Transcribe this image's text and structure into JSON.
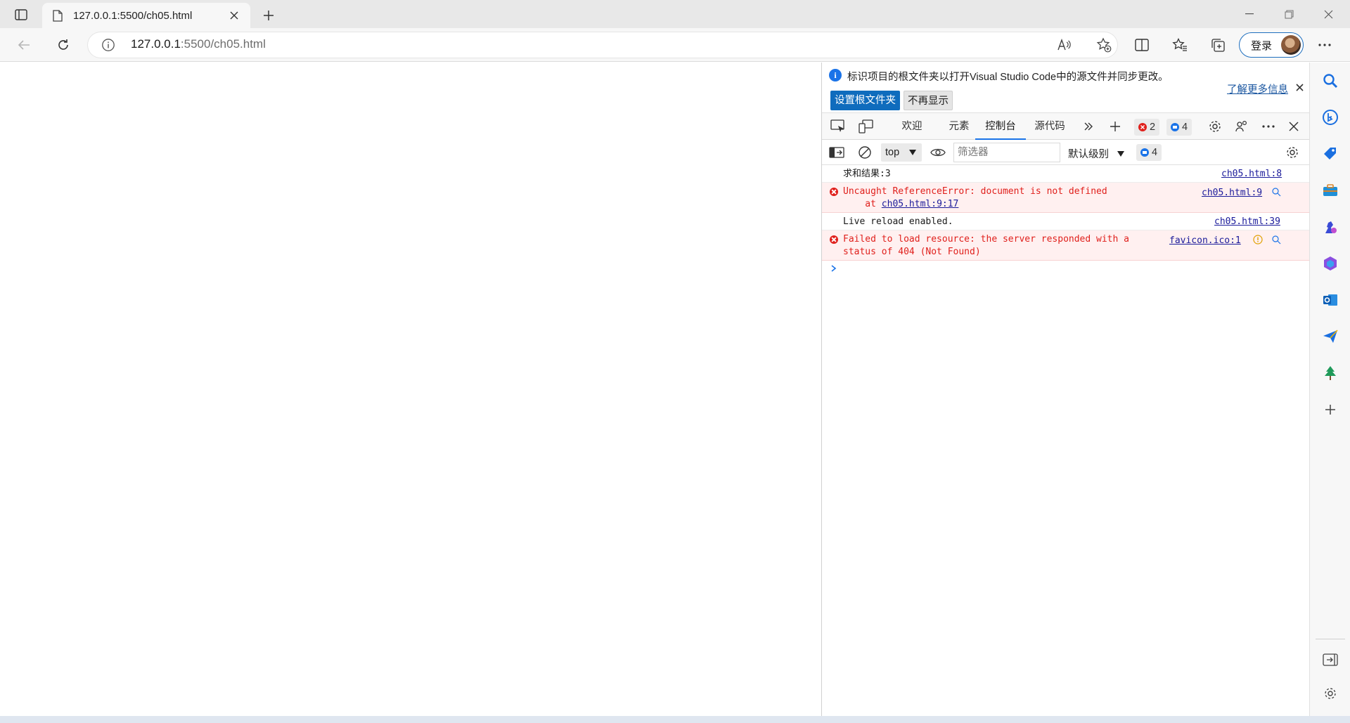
{
  "tab": {
    "title": "127.0.0.1:5500/ch05.html"
  },
  "address": {
    "host": "127.0.0.1",
    "path": ":5500/ch05.html"
  },
  "toolbar": {
    "login_label": "登录"
  },
  "devtools": {
    "infobar": {
      "message": "标识项目的根文件夹以打开Visual Studio Code中的源文件并同步更改。",
      "learn_more": "了解更多信息",
      "primary_button": "设置根文件夹",
      "secondary_button": "不再显示"
    },
    "tabs": [
      "欢迎",
      "元素",
      "控制台",
      "源代码"
    ],
    "active_tab": "控制台",
    "error_count": "2",
    "message_count": "4",
    "console_toolbar": {
      "context": "top",
      "filter_placeholder": "筛选器",
      "levels": "默认级别",
      "message_count": "4"
    },
    "messages": [
      {
        "level": "log",
        "text": "求和结果:3",
        "source": "ch05.html:8"
      },
      {
        "level": "error",
        "text": "Uncaught ReferenceError: document is not defined",
        "detail_prefix": "    at ",
        "detail_link": "ch05.html:9:17",
        "source": "ch05.html:9"
      },
      {
        "level": "log",
        "text": "Live reload enabled.",
        "source": "ch05.html:39"
      },
      {
        "level": "error",
        "text": "Failed to load resource: the server responded with a",
        "text2": "status of 404 (Not Found)",
        "source": "favicon.ico:1"
      }
    ]
  },
  "colors": {
    "accent": "#0f6cbd",
    "error": "#e0201c",
    "error_bg": "#fff0f0",
    "link": "#1a1a9a"
  },
  "icons": [
    "sidebar-toggle-icon",
    "page-icon",
    "close-icon",
    "plus-icon",
    "back-icon",
    "refresh-icon",
    "info-icon",
    "read-aloud-icon",
    "favorite-add-icon",
    "split-screen-icon",
    "favorites-icon",
    "collections-icon",
    "more-icon",
    "search-icon",
    "bing-icon",
    "shopping-icon",
    "tools-icon",
    "games-icon",
    "office-icon",
    "outlook-icon",
    "send-icon",
    "tree-icon",
    "add-icon",
    "sidebar-hide-icon",
    "settings-icon"
  ]
}
